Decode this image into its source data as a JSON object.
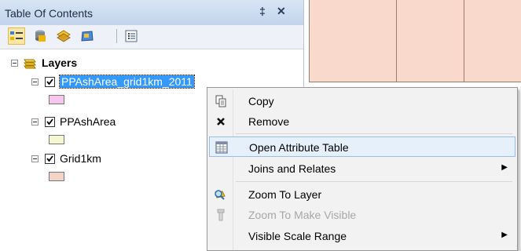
{
  "toc": {
    "title": "Table Of Contents",
    "pin_glyph": "‡",
    "close_glyph": "✕",
    "toolbar": [
      "list-by-drawing-order-icon",
      "list-by-source-icon",
      "list-by-visibility-icon",
      "list-by-selection-icon",
      "options-icon"
    ],
    "root_label": "Layers",
    "layers": [
      {
        "label": "PPAshArea_grid1km_2011",
        "checked": true,
        "selected": true,
        "swatch": "#f6c6ef"
      },
      {
        "label": "PPAshArea",
        "checked": true,
        "selected": false,
        "swatch": "#f4f7cf"
      },
      {
        "label": "Grid1km",
        "checked": true,
        "selected": false,
        "swatch": "#f5d4c8"
      }
    ]
  },
  "map": {
    "fill": "#f8d9cc",
    "stroke": "#9c7a70"
  },
  "context_menu": {
    "items": [
      {
        "label": "Copy",
        "icon": "copy-icon",
        "enabled": true,
        "submenu": false
      },
      {
        "label": "Remove",
        "icon": "remove-icon",
        "enabled": true,
        "submenu": false
      },
      {
        "label": "Open Attribute Table",
        "icon": "table-icon",
        "enabled": true,
        "submenu": false,
        "highlighted": true
      },
      {
        "label": "Joins and Relates",
        "icon": "",
        "enabled": true,
        "submenu": true
      },
      {
        "label": "Zoom To Layer",
        "icon": "zoom-to-layer-icon",
        "enabled": true,
        "submenu": false
      },
      {
        "label": "Zoom To Make Visible",
        "icon": "zoom-to-make-visible-icon",
        "enabled": false,
        "submenu": false
      },
      {
        "label": "Visible Scale Range",
        "icon": "",
        "enabled": true,
        "submenu": true
      }
    ],
    "submenu_glyph": "▶"
  }
}
